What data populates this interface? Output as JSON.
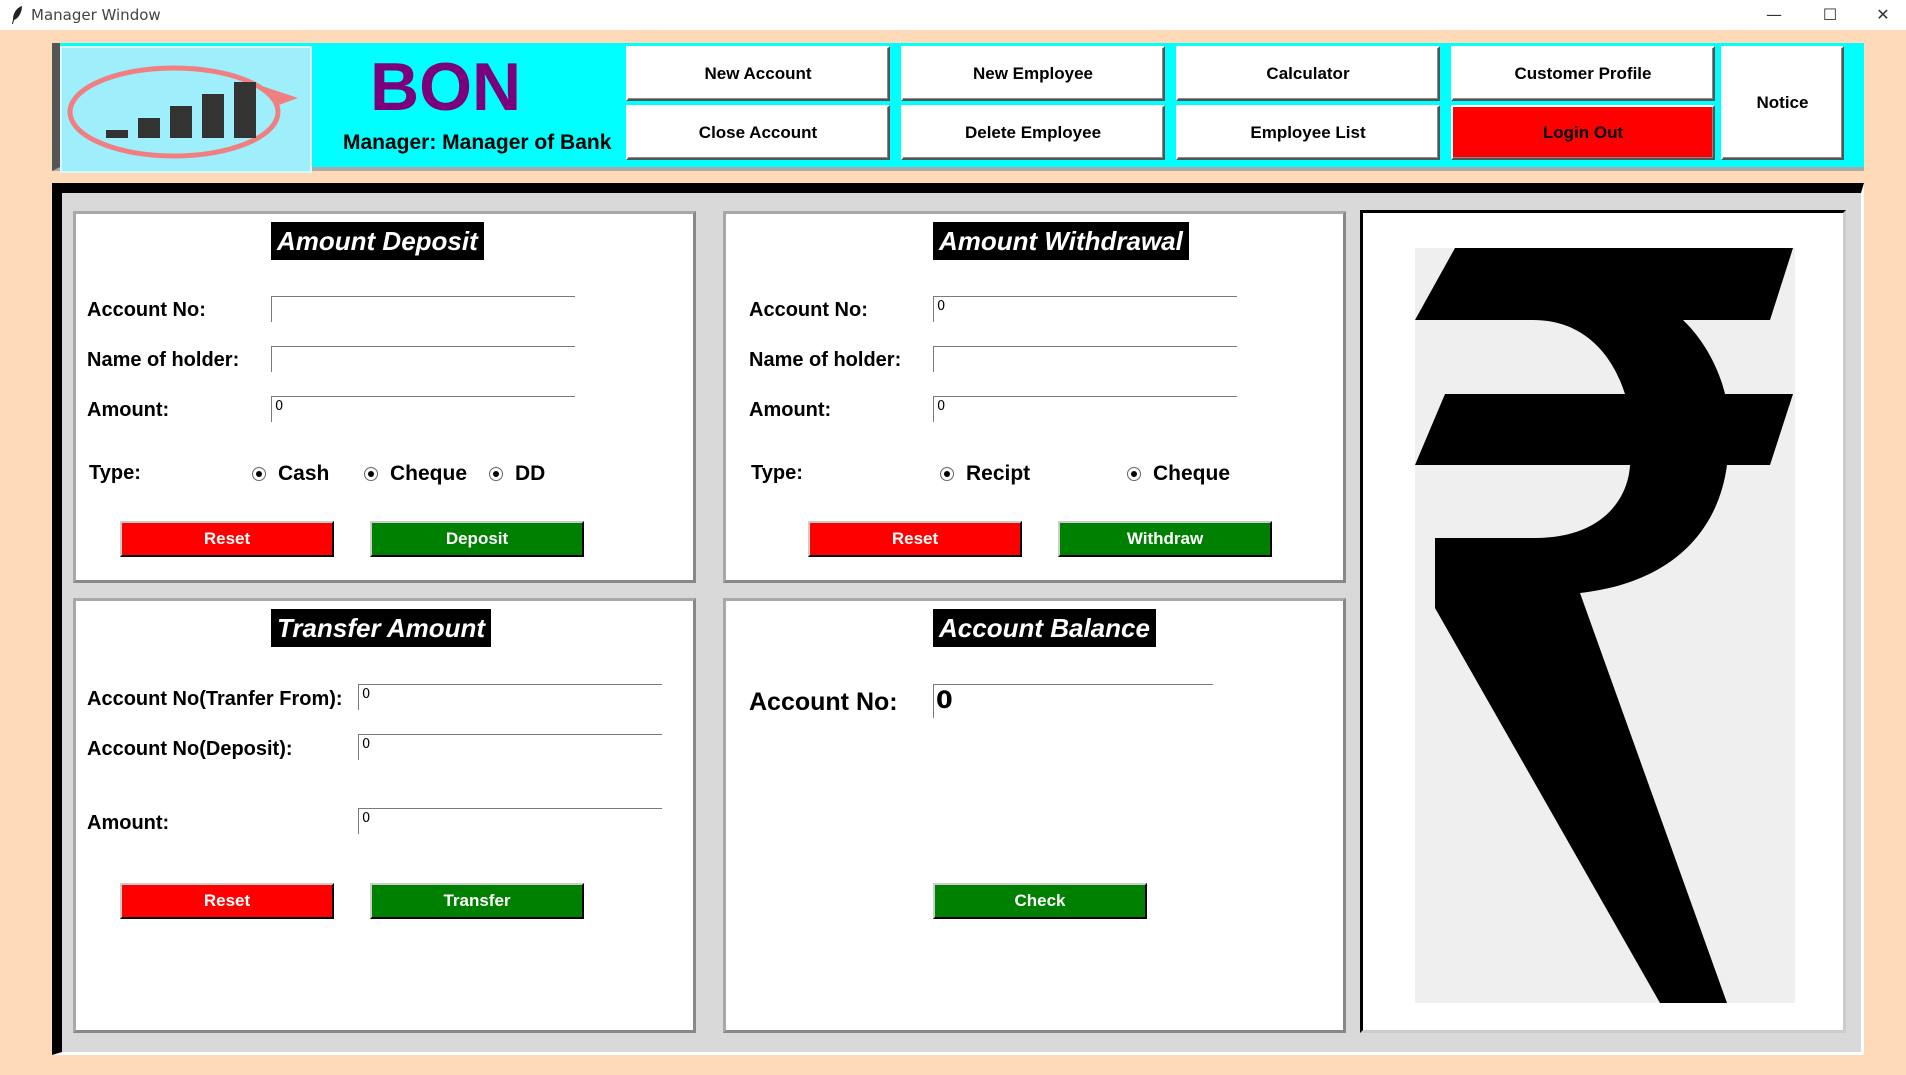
{
  "window": {
    "title": "Manager Window",
    "minimize_glyph": "—",
    "maximize_glyph": "☐",
    "close_glyph": "✕"
  },
  "header": {
    "brand": "BON",
    "manager_label": "Manager: Manager of Bank",
    "buttons": {
      "new_account": "New Account",
      "close_account": "Close Account",
      "new_employee": "New Employee",
      "delete_employee": "Delete Employee",
      "calculator": "Calculator",
      "employee_list": "Employee List",
      "customer_profile": "Customer Profile",
      "login_out": "Login Out",
      "notice": "Notice"
    }
  },
  "deposit": {
    "title": "Amount Deposit",
    "account_no_label": "Account No:",
    "account_no_value": "",
    "holder_label": "Name of holder:",
    "holder_value": "",
    "amount_label": "Amount:",
    "amount_value": "0",
    "type_label": "Type:",
    "type_options": [
      "Cash",
      "Cheque",
      "DD"
    ],
    "reset_label": "Reset",
    "submit_label": "Deposit"
  },
  "withdrawal": {
    "title": "Amount Withdrawal",
    "account_no_label": "Account No:",
    "account_no_value": "0",
    "holder_label": "Name of holder:",
    "holder_value": "",
    "amount_label": "Amount:",
    "amount_value": "0",
    "type_label": "Type:",
    "type_options": [
      "Recipt",
      "Cheque"
    ],
    "reset_label": "Reset",
    "submit_label": "Withdraw"
  },
  "transfer": {
    "title": "Transfer Amount",
    "from_label": "Account No(Tranfer From):",
    "from_value": "0",
    "to_label": "Account No(Deposit):",
    "to_value": "0",
    "amount_label": "Amount:",
    "amount_value": "0",
    "reset_label": "Reset",
    "submit_label": "Transfer"
  },
  "balance": {
    "title": "Account Balance",
    "account_no_label": "Account No:",
    "account_no_value": "0",
    "check_label": "Check"
  },
  "icons": {
    "app": "feather-icon",
    "logo": "growth-chart-logo",
    "currency": "rupee-symbol-icon"
  },
  "colors": {
    "background": "#ffdab9",
    "header": "#00ffff",
    "brand": "#7b007b",
    "reset": "#ff0000",
    "action": "#008000"
  }
}
